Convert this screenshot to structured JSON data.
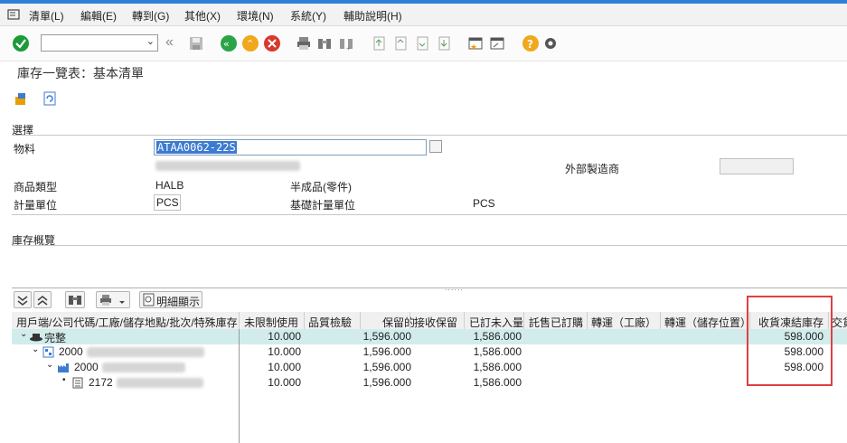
{
  "menu": [
    "清單(L)",
    "編輯(E)",
    "轉到(G)",
    "其他(X)",
    "環境(N)",
    "系統(Y)",
    "輔助說明(H)"
  ],
  "toolbar": {
    "command_value": "",
    "icons": [
      "check-icon",
      "back-icon",
      "save-icon",
      "back-green-icon",
      "exit-icon",
      "cancel-icon",
      "print-icon",
      "find-icon",
      "find-next-icon",
      "first-page-icon",
      "prev-page-icon",
      "next-page-icon",
      "last-page-icon",
      "new-session-icon",
      "shortcut-icon",
      "help-icon",
      "settings-icon"
    ]
  },
  "page_title": "庫存一覽表：基本清單",
  "selection": {
    "header": "選擇",
    "material_label": "物料",
    "material_value": "ATAA0062-22S",
    "external_mfr_label": "外部製造商",
    "material_type_label": "商品類型",
    "material_type_value": "HALB",
    "material_type_desc": "半成品(零件)",
    "unit_label": "計量單位",
    "unit_value": "PCS",
    "base_unit_label": "基礎計量單位",
    "base_unit_value": "PCS"
  },
  "overview": {
    "header": "庫存概覽"
  },
  "grid": {
    "detail_button": "明細顯示",
    "columns": [
      "用戶端/公司代碼/工廠/儲存地點/批次/特殊庫存",
      "未限制使用",
      "品質檢驗",
      "保留的",
      "接收保留",
      "已訂未入量",
      "託售已訂購",
      "轉運（工廠）",
      "轉運（儲存位置）",
      "收貨凍結庫存",
      "交貨"
    ],
    "rows": [
      {
        "label": "完整",
        "unrestricted": "10.000",
        "quality": "1,596.000",
        "reserved": "",
        "receipt_res": "1,586.000",
        "gr_blocked": "598.000"
      },
      {
        "label": "2000",
        "unrestricted": "10.000",
        "quality": "1,596.000",
        "reserved": "",
        "receipt_res": "1,586.000",
        "gr_blocked": "598.000"
      },
      {
        "label": "2000",
        "unrestricted": "10.000",
        "quality": "1,596.000",
        "reserved": "",
        "receipt_res": "1,586.000",
        "gr_blocked": "598.000"
      },
      {
        "label": "2172",
        "unrestricted": "10.000",
        "quality": "1,596.000",
        "reserved": "",
        "receipt_res": "1,586.000",
        "gr_blocked": ""
      }
    ]
  },
  "colors": {
    "accent": "#2f7fd8",
    "highlight_row": "#d2ecec",
    "annotation": "#e04040"
  }
}
